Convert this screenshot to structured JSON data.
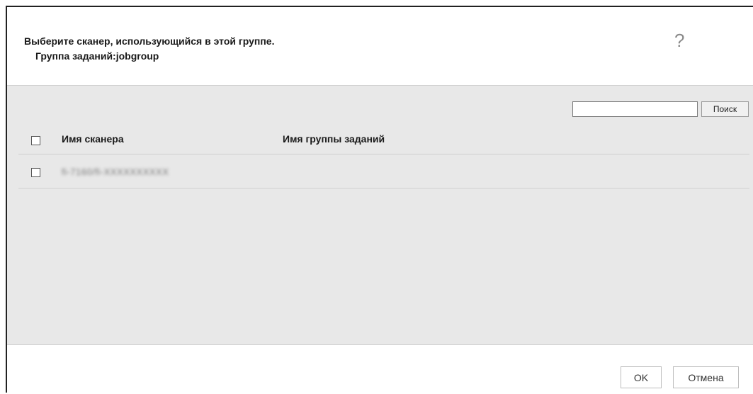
{
  "dialog": {
    "title": "Выберите сканер, использующийся в этой группе.",
    "subtitle": "Группа заданий:jobgroup",
    "help_icon": "?"
  },
  "search": {
    "value": "",
    "button_label": "Поиск"
  },
  "table": {
    "columns": [
      "Имя сканера",
      "Имя группы заданий"
    ],
    "rows": [
      {
        "scanner_name": "fi-7160/fi-XXXXXXXXXX",
        "job_group": ""
      }
    ]
  },
  "footer": {
    "ok_label": "OK",
    "cancel_label": "Отмена"
  }
}
